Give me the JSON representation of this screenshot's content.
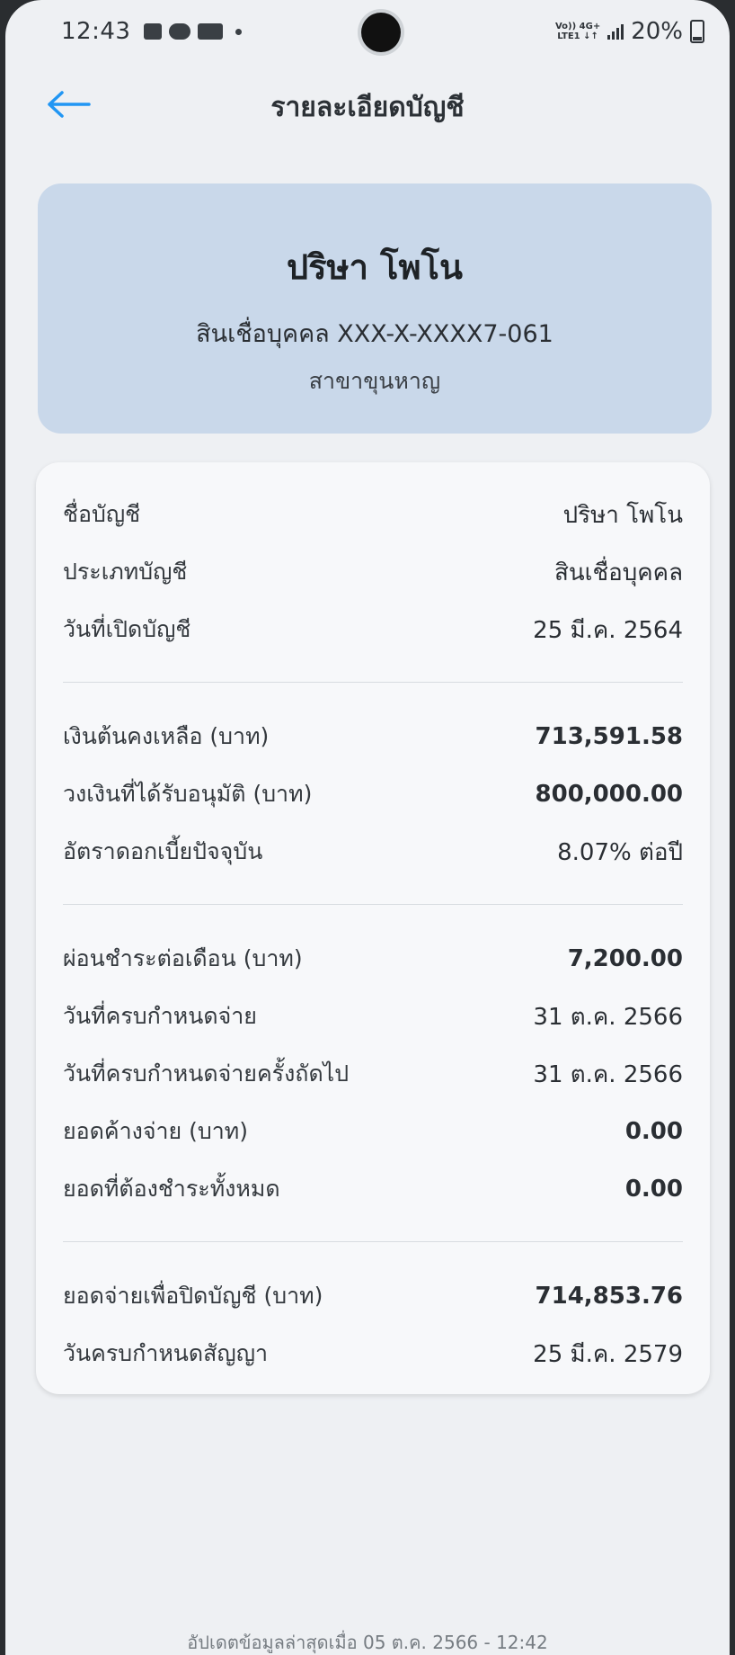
{
  "status_bar": {
    "time": "12:43",
    "net_top": "Vo)) 4G+",
    "net_bottom": "LTE1 ↓↑",
    "battery": "20%"
  },
  "header": {
    "title": "รายละเอียดบัญชี",
    "back_icon": "arrow-left-icon",
    "accent_color": "#2196f3"
  },
  "summary": {
    "name": "ปริษา โพโน",
    "account": "สินเชื่อบุคคล XXX-X-XXXX7-061",
    "branch": "สาขาขุนหาญ"
  },
  "sections": [
    {
      "rows": [
        {
          "label": "ชื่อบัญชี",
          "value": "ปริษา โพโน",
          "bold": false
        },
        {
          "label": "ประเภทบัญชี",
          "value": "สินเชื่อบุคคล",
          "bold": false
        },
        {
          "label": "วันที่เปิดบัญชี",
          "value": "25 มี.ค. 2564",
          "bold": false
        }
      ]
    },
    {
      "rows": [
        {
          "label": "เงินต้นคงเหลือ (บาท)",
          "value": "713,591.58",
          "bold": true
        },
        {
          "label": "วงเงินที่ได้รับอนุมัติ (บาท)",
          "value": "800,000.00",
          "bold": true
        },
        {
          "label": "อัตราดอกเบี้ยปัจจุบัน",
          "value": "8.07% ต่อปี",
          "bold": false
        }
      ]
    },
    {
      "rows": [
        {
          "label": "ผ่อนชำระต่อเดือน (บาท)",
          "value": "7,200.00",
          "bold": true
        },
        {
          "label": "วันที่ครบกำหนดจ่าย",
          "value": "31 ต.ค. 2566",
          "bold": false
        },
        {
          "label": "วันที่ครบกำหนดจ่ายครั้งถัดไป",
          "value": "31 ต.ค. 2566",
          "bold": false
        },
        {
          "label": "ยอดค้างจ่าย (บาท)",
          "value": "0.00",
          "bold": true
        },
        {
          "label": "ยอดที่ต้องชำระทั้งหมด",
          "value": "0.00",
          "bold": true
        }
      ]
    },
    {
      "rows": [
        {
          "label": "ยอดจ่ายเพื่อปิดบัญชี (บาท)",
          "value": "714,853.76",
          "bold": true
        },
        {
          "label": "วันครบกำหนดสัญญา",
          "value": "25 มี.ค. 2579",
          "bold": false
        }
      ]
    }
  ],
  "footer": {
    "updated": "อัปเดตข้อมูลล่าสุดเมื่อ 05 ต.ค. 2566 - 12:42"
  }
}
